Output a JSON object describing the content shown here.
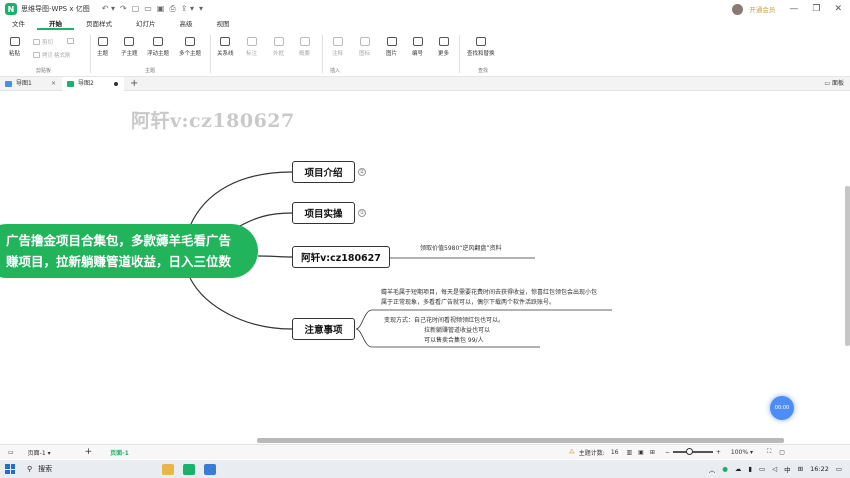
{
  "window": {
    "title": "思维导图-WPS x 亿图",
    "logo_glyph": "N",
    "qa_icons": [
      "undo-icon",
      "redo-icon",
      "new-file-icon",
      "open-icon",
      "save-icon",
      "print-icon",
      "export-icon",
      "more-icon"
    ],
    "qa_glyphs": [
      "↶ ▾",
      "↷",
      "▢",
      "▭",
      "▣",
      "⎙",
      "⇪ ▾",
      "▾"
    ],
    "vip_label": "开通会员",
    "controls": [
      "—",
      "❐",
      "✕"
    ]
  },
  "menu": {
    "tabs": [
      "文件",
      "开始",
      "页面样式",
      "幻灯片",
      "高级",
      "视图"
    ],
    "active": "开始"
  },
  "ribbon": {
    "paste": "粘贴",
    "cut": "剪切",
    "copy": "拷贝",
    "format_painter": "格式刷",
    "clipboard_group": "剪贴板",
    "topic": "主题",
    "subtopic": "子主题",
    "floating_topic": "浮动主题",
    "multi_topic": "多个主题",
    "topic_group": "主题",
    "relationship": "关系线",
    "callout": "标注",
    "boundary": "外框",
    "summary": "概要",
    "note": "注释",
    "icon": "图标",
    "picture": "图片",
    "numbering": "编号",
    "more": "更多",
    "insert_group": "插入",
    "find_replace": "查找和替换",
    "find_group": "查找"
  },
  "doc_tabs": [
    {
      "label": "导图1"
    },
    {
      "label": "导图2"
    }
  ],
  "panel_label": "面板",
  "canvas": {
    "watermark": "阿轩v:cz180627",
    "central_topic": {
      "line1": "广告撸金项目合集包，多款薅羊毛看广告",
      "line2": "赚项目，拉新躺赚管道收益，日入三位数",
      "color": "#22b45b"
    },
    "topics": [
      {
        "label": "项目介绍",
        "badge": "②"
      },
      {
        "label": "项目实操",
        "badge": "①"
      },
      {
        "label": "阿轩v:cz180627",
        "note": "领取价值5980“逆风翻盘”资料"
      },
      {
        "label": "注意事项",
        "note_block_1": [
          "薅羊毛属于短期项目，每天是需要花费时间去获得收益，惊喜红包领包会出现小包",
          "属于正常现象，多看看广告就可以，偶尔下载两个软件活跃账号。"
        ],
        "note_block_2": [
          "变现方式：自己花时间看视频领红包也可以。",
          "拉新躺赚管道收益也可以",
          "可以售卖合集包 99/人"
        ]
      }
    ],
    "float_button": "00:00"
  },
  "statusbar": {
    "page_selector": "页面-1",
    "page_tab": "页面-1",
    "topic_count_label": "主题计数:",
    "topic_count": "16",
    "zoom_label": "100%"
  },
  "taskbar": {
    "search_label": "搜索",
    "ime": "中",
    "time": "16:22"
  }
}
